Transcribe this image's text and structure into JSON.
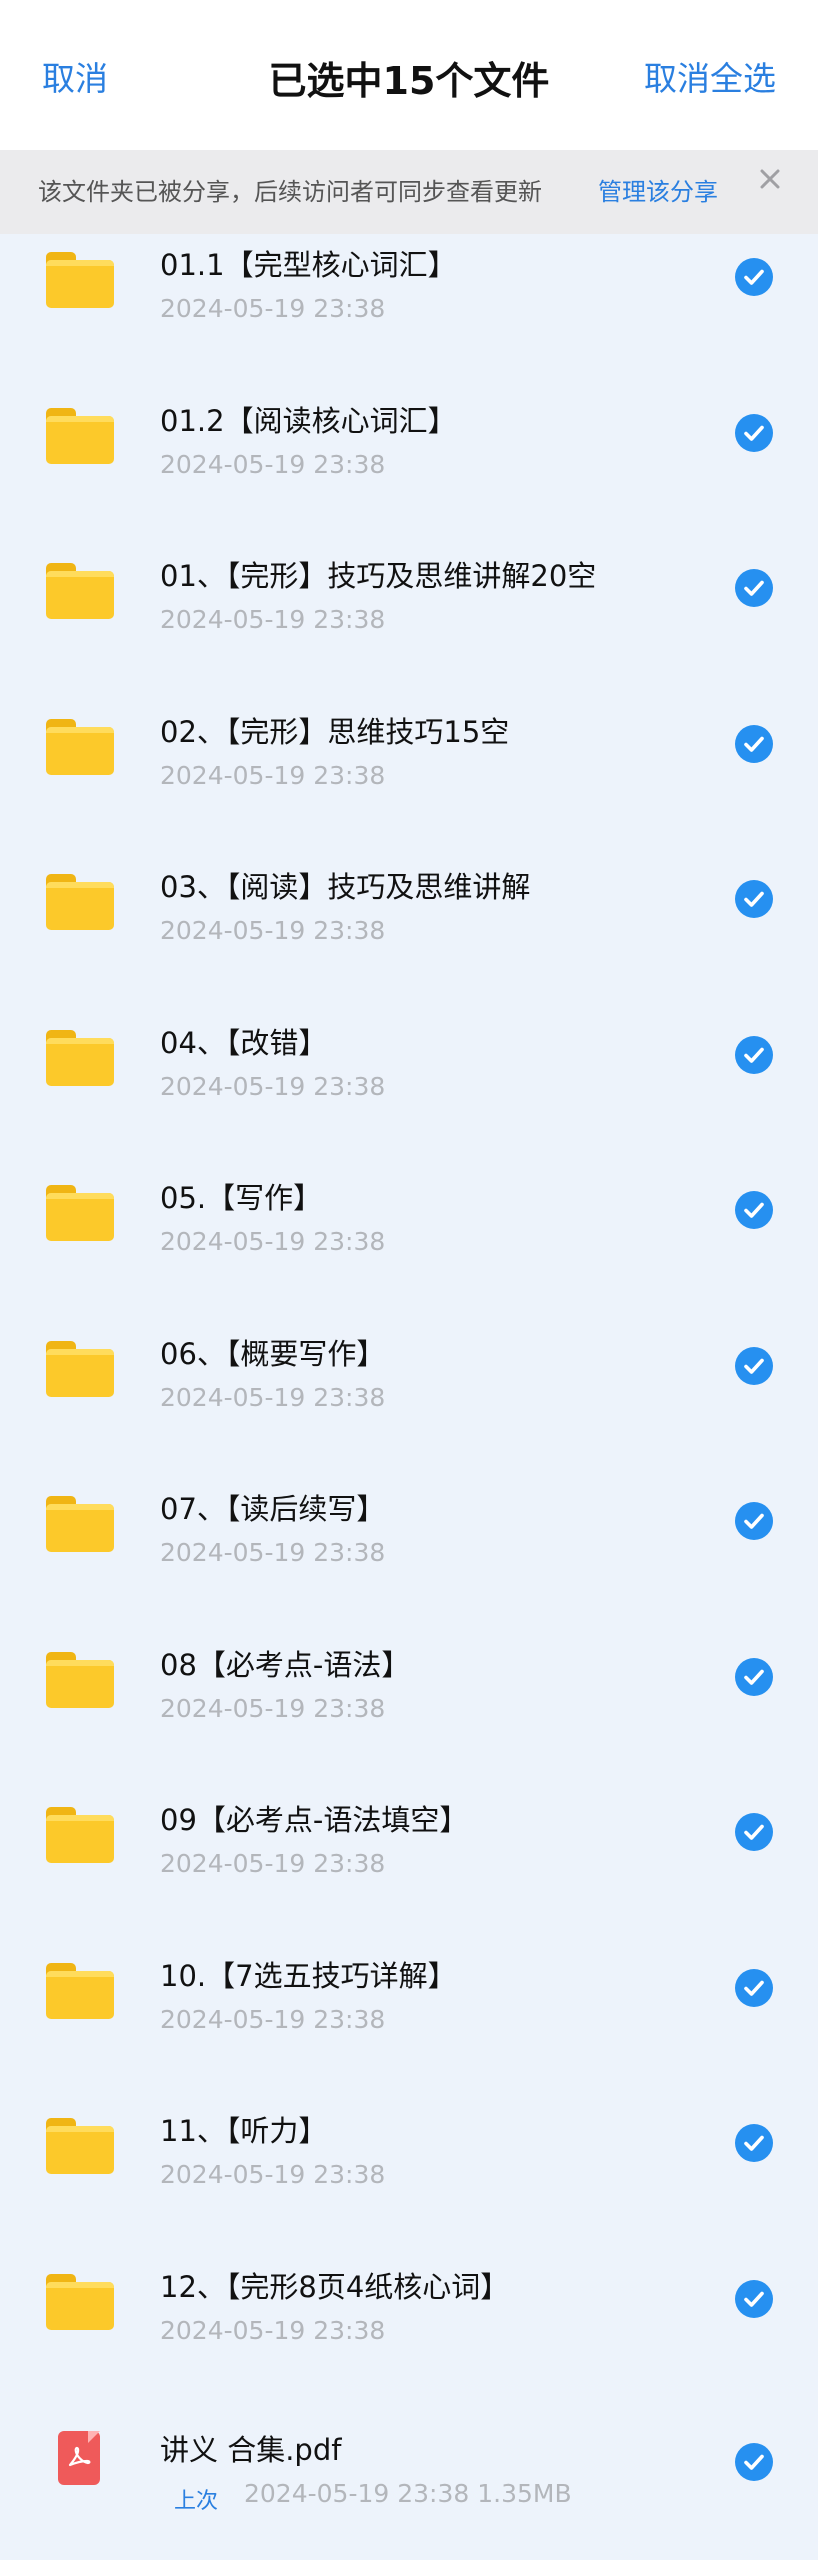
{
  "header": {
    "cancel_label": "取消",
    "title": "已选中15个文件",
    "deselect_all_label": "取消全选"
  },
  "notice": {
    "message": "该文件夹已被分享，后续访问者可同步查看更新",
    "manage_label": "管理该分享",
    "close_icon": "close-icon"
  },
  "files": [
    {
      "name": "01.1【完型核心词汇】",
      "date": "2024-05-19  23:38",
      "type": "folder",
      "selected": true
    },
    {
      "name": "01.2【阅读核心词汇】",
      "date": "2024-05-19  23:38",
      "type": "folder",
      "selected": true
    },
    {
      "name": "01、【完形】技巧及思维讲解20空",
      "date": "2024-05-19  23:38",
      "type": "folder",
      "selected": true
    },
    {
      "name": "02、【完形】思维技巧15空",
      "date": "2024-05-19  23:38",
      "type": "folder",
      "selected": true
    },
    {
      "name": "03、【阅读】技巧及思维讲解",
      "date": "2024-05-19  23:38",
      "type": "folder",
      "selected": true
    },
    {
      "name": "04、【改错】",
      "date": "2024-05-19  23:38",
      "type": "folder",
      "selected": true
    },
    {
      "name": "05.【写作】",
      "date": "2024-05-19  23:38",
      "type": "folder",
      "selected": true
    },
    {
      "name": "06、【概要写作】",
      "date": "2024-05-19  23:38",
      "type": "folder",
      "selected": true
    },
    {
      "name": "07、【读后续写】",
      "date": "2024-05-19  23:38",
      "type": "folder",
      "selected": true
    },
    {
      "name": "08【必考点-语法】",
      "date": "2024-05-19  23:38",
      "type": "folder",
      "selected": true
    },
    {
      "name": "09【必考点-语法填空】",
      "date": "2024-05-19  23:38",
      "type": "folder",
      "selected": true
    },
    {
      "name": "10.【7选五技巧详解】",
      "date": "2024-05-19  23:38",
      "type": "folder",
      "selected": true
    },
    {
      "name": "11、【听力】",
      "date": "2024-05-19  23:38",
      "type": "folder",
      "selected": true
    },
    {
      "name": "12、【完形8页4纸核心词】",
      "date": "2024-05-19  23:38",
      "type": "folder",
      "selected": true
    }
  ],
  "pdf_file": {
    "name": "讲义 合集.pdf",
    "tag": "上次",
    "meta": "2024-05-19  23:38   1.35MB",
    "selected": true
  },
  "colors": {
    "accent": "#2a7fe0",
    "check": "#2690f0",
    "folder": "#fcc92a",
    "list_bg": "#edf3fb"
  }
}
